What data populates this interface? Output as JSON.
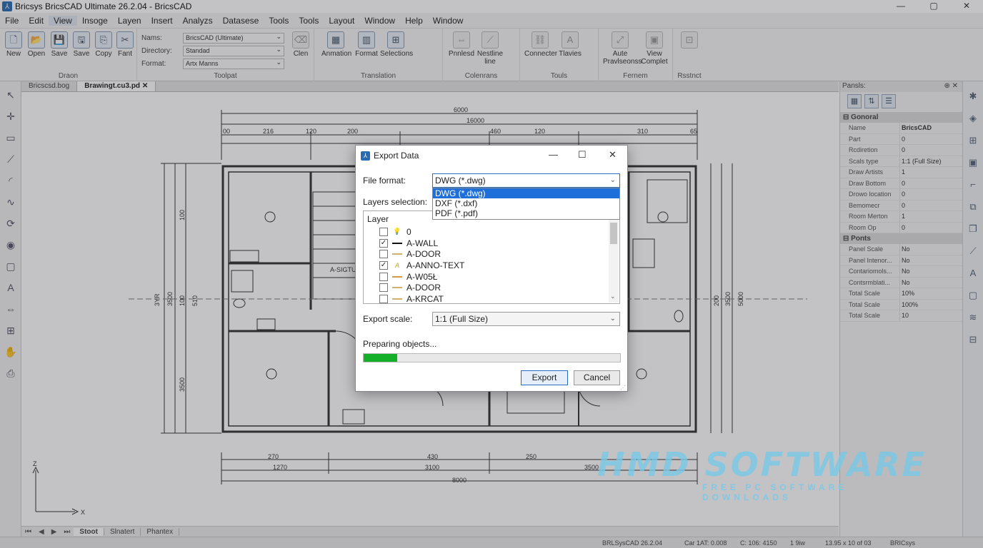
{
  "window": {
    "title": "Bricsys BricsCAD Ultimate 26.2.04 - BricsCAD",
    "minimize": "—",
    "maximize": "▢",
    "close": "✕"
  },
  "menu": [
    "File",
    "Edit",
    "View",
    "Insoge",
    "Layen",
    "Insert",
    "Analyzs",
    "Datasese",
    "Tools",
    "Tools",
    "Layout",
    "Window",
    "Help",
    "Window"
  ],
  "ribbon": {
    "draw_buttons": [
      "New",
      "Open",
      "Save",
      "Save",
      "Copy",
      "Fant"
    ],
    "draw_group": "Draon",
    "toolpat_fields": [
      {
        "label": "Nams:",
        "value": "BricsCAD (Ultimate)"
      },
      {
        "label": "Directory:",
        "value": "Standad"
      },
      {
        "label": "Format:",
        "value": "Artx Manns"
      }
    ],
    "clen_label": "Clen",
    "toolpat_group": "Toolpat",
    "translation_buttons": [
      "Anmation",
      "Format",
      "Selections"
    ],
    "translation_group": "Translation",
    "colenrans_buttons": [
      "Pnnlesd",
      "Nestline line"
    ],
    "colenrans_group": "Colenrans",
    "tools_buttons": [
      "Connecter",
      "Tlavies"
    ],
    "tools_group": "Touls",
    "fernem_buttons": [
      "Aute Pravlseonss",
      "View Complet"
    ],
    "fernem_group": "Fernem",
    "rsstnct_group": "Rsstnct"
  },
  "doc_tabs": [
    "Bricscsd.bog",
    "Brawingt.cu3.pd"
  ],
  "drawing": {
    "dims_top": [
      "6000",
      "16000",
      "00",
      "216",
      "120",
      "200",
      "460",
      "120",
      "310",
      "65"
    ],
    "dims_bottom": [
      "270",
      "430",
      "250",
      "1270",
      "3100",
      "3500",
      "8000"
    ],
    "dims_left": [
      "3YR",
      "3500",
      "100",
      "100",
      "3500",
      "510"
    ],
    "dims_right": [
      "200",
      "3500",
      "5000"
    ],
    "room_label": "A-SIGTU",
    "ucs_y": "Z",
    "ucs_x": "X"
  },
  "layout_tabs": [
    "Stoot",
    "Slnatert",
    "Phantex"
  ],
  "layout_nav": [
    "⏮",
    "◀",
    "▶",
    "⏭"
  ],
  "status": [
    "BRLSysCAD 26.2.04",
    "Car 1AT: 0.008",
    "C: 106: 4150",
    "1 9iw",
    "13.95 x 10 of 03",
    "BRICsys"
  ],
  "panels": {
    "title": "Pansls:",
    "pin": "⊕ ✕",
    "sections": [
      {
        "name": "Gonoral",
        "rows": [
          [
            "Name",
            "BricsCAD"
          ],
          [
            "Part",
            "0"
          ],
          [
            "Rcdiretion",
            "0"
          ],
          [
            "Scals type",
            "1:1 (Full Size)"
          ],
          [
            "Draw Artists",
            "1"
          ],
          [
            "Draw Bottom",
            "0"
          ],
          [
            "Drowo location",
            "0"
          ],
          [
            "Bemomecr",
            "0"
          ],
          [
            "Room Merton",
            "1"
          ],
          [
            "Room Op",
            "0"
          ]
        ]
      },
      {
        "name": "Ponts",
        "rows": [
          [
            "Panel Scale",
            "No"
          ],
          [
            "Panel Intenor...",
            "No"
          ],
          [
            "Contariomols...",
            "No"
          ],
          [
            "Contsrmblati...",
            "No"
          ],
          [
            "Total Scale",
            "10%"
          ],
          [
            "Total Scale",
            "100%"
          ],
          [
            "Total Scale",
            "10"
          ]
        ]
      }
    ]
  },
  "dialog": {
    "title": "Export Data",
    "file_format_label": "File format:",
    "file_format_value": "DWG (*.dwg)",
    "format_options": [
      "DWG (*.dwg)",
      "DXF (*.dxf)",
      "PDF (*.pdf)"
    ],
    "layers_label": "Layers selection:",
    "layer_header": "Layer",
    "layers": [
      {
        "name": "0",
        "checked": false,
        "swatch": "bulb"
      },
      {
        "name": "A-WALL",
        "checked": true,
        "swatch": "line-black"
      },
      {
        "name": "A-DOOR",
        "checked": false,
        "swatch": "line-tan"
      },
      {
        "name": "A-ANNO-TEXT",
        "checked": true,
        "swatch": "text"
      },
      {
        "name": "A-W05Ł",
        "checked": false,
        "swatch": "line-orange"
      },
      {
        "name": "A-DOOR",
        "checked": false,
        "swatch": "line-tan"
      },
      {
        "name": "A-KRCAT",
        "checked": false,
        "swatch": "line-tan"
      }
    ],
    "export_scale_label": "Export scale:",
    "export_scale_value": "1:1 (Full Size)",
    "progress_label": "Preparing objects...",
    "progress": 0.13,
    "export_button": "Export",
    "cancel_button": "Cancel"
  },
  "watermark": {
    "big": "HMD SOFTWARE",
    "small": "FREE PC SOFTWARE DOWNLOADS"
  },
  "colors": {
    "accent": "#1e6fd9",
    "progress": "#15b02a",
    "dim_overlay": "rgba(40,40,50,0.28)"
  }
}
